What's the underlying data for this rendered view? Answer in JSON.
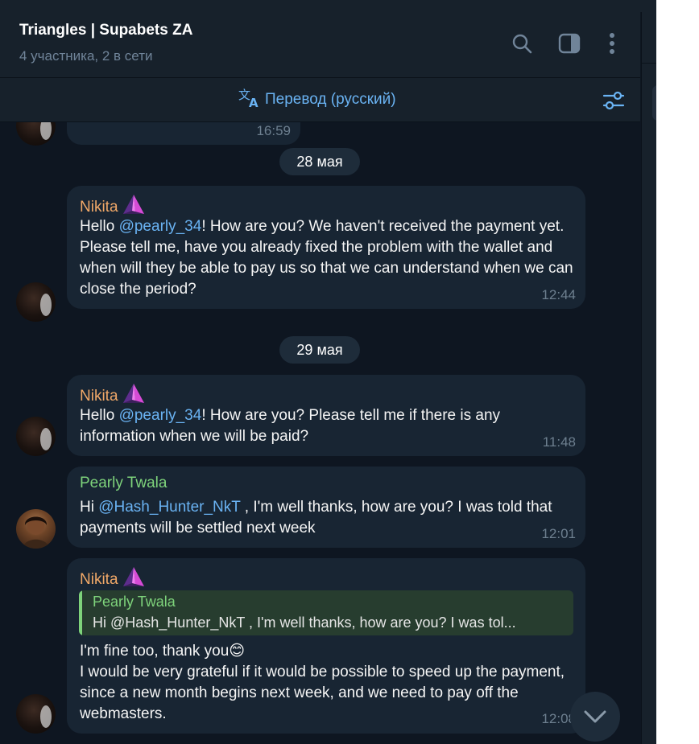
{
  "header": {
    "title": "Triangles | Supabets ZA",
    "subtitle": "4 участника, 2 в сети",
    "icons": [
      "search-icon",
      "sidebar-toggle-icon",
      "more-vertical-icon"
    ]
  },
  "translation_bar": {
    "label": "Перевод (русский)",
    "icon": "translate-icon",
    "settings_icon": "settings-sliders-icon"
  },
  "top_partial_message": {
    "time": "16:59"
  },
  "date_separators": [
    "28 мая",
    "29 мая"
  ],
  "messages": [
    {
      "sender": "Nikita",
      "text_before": "Hello ",
      "mention": "@pearly_34",
      "text_after": "! How are you? We haven't received the payment yet. Please tell me, have you already fixed the problem with the wallet and when will they be able to pay us so that we can understand when we can close the period?",
      "time": "12:44"
    },
    {
      "sender": "Nikita",
      "text_before": "Hello ",
      "mention": "@pearly_34",
      "text_after": "! How are you? Please tell me if there is any information when we will be paid?",
      "time": "11:48"
    },
    {
      "sender": "Pearly Twala",
      "text_before": "Hi ",
      "mention": "@Hash_Hunter_NkT",
      "text_after": " , I'm well thanks, how are you? I was told that payments will be settled next week",
      "time": "12:01"
    },
    {
      "sender": "Nikita",
      "reply_to": {
        "name": "Pearly Twala",
        "text": "Hi @Hash_Hunter_NkT , I'm well thanks, how are you? I was tol..."
      },
      "line1": "I'm fine too, thank you",
      "emoji": "😊",
      "line2": "I would be very grateful if it would be possible to speed up the payment, since a new month begins next week, and we need to pay off the webmasters.",
      "time": "12:08"
    }
  ],
  "colors": {
    "background": "#0e1621",
    "panel": "#17212b",
    "bubble": "#182533",
    "accent": "#6ab3f3",
    "nikita": "#f0a868",
    "pearly": "#7ed37b"
  }
}
